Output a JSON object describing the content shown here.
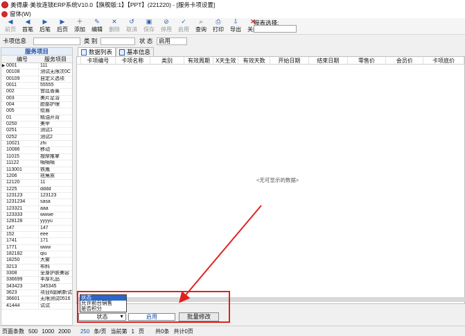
{
  "window": {
    "title": "美得康·美妆连锁ERP系统V10.0【旗舰版:1】【PPT】(221220) - [服务卡项设置]"
  },
  "menu": {
    "label": "窗体(W)"
  },
  "toolbar": {
    "buttons": [
      {
        "label": "前页",
        "icon": "◀",
        "disabled": true
      },
      {
        "label": "首笔",
        "icon": "◀",
        "disabled": false
      },
      {
        "label": "后笔",
        "icon": "▶",
        "disabled": false
      },
      {
        "label": "后页",
        "icon": "▶",
        "disabled": false
      },
      {
        "label": "添加",
        "icon": "＋",
        "disabled": false
      },
      {
        "label": "编辑",
        "icon": "✎",
        "disabled": false
      },
      {
        "label": "删除",
        "icon": "✕",
        "disabled": true
      },
      {
        "label": "取消",
        "icon": "↺",
        "disabled": true
      },
      {
        "label": "保存",
        "icon": "▣",
        "disabled": true
      },
      {
        "label": "停用",
        "icon": "⊘",
        "disabled": true
      },
      {
        "label": "启用",
        "icon": "✓",
        "disabled": true
      },
      {
        "label": "查询",
        "icon": "⌕",
        "disabled": false
      },
      {
        "label": "打印",
        "icon": "⎙",
        "disabled": false
      },
      {
        "label": "导出",
        "icon": "⇩",
        "disabled": false
      },
      {
        "label": "关闭",
        "icon": "✕",
        "disabled": false
      }
    ],
    "report_label": "报表选择:"
  },
  "filter": {
    "card_info_label": "卡项信息",
    "category_label": "类 别",
    "status_label": "状 态",
    "status_value": "启用"
  },
  "left": {
    "title": "服务项目",
    "col_code": "编号",
    "col_name": "服务项目",
    "rows": [
      {
        "code": "0001",
        "name": "111"
      },
      {
        "code": "00108",
        "name": "测试无限次0C"
      },
      {
        "code": "00109",
        "name": "自定义选项"
      },
      {
        "code": "0011",
        "name": "55555"
      },
      {
        "code": "002",
        "name": "宫廷香薰"
      },
      {
        "code": "003",
        "name": "美片足浴"
      },
      {
        "code": "004",
        "name": "脸部护理"
      },
      {
        "code": "005",
        "name": "绘眉"
      },
      {
        "code": "01",
        "name": "精油开背"
      },
      {
        "code": "0250",
        "name": "美甲"
      },
      {
        "code": "0251",
        "name": "测试1"
      },
      {
        "code": "0252",
        "name": "测试2"
      },
      {
        "code": "10021",
        "name": "zhi"
      },
      {
        "code": "10086",
        "name": "移动"
      },
      {
        "code": "11015",
        "name": "按摩推拿"
      },
      {
        "code": "11122",
        "name": "嘀嘀嘀"
      },
      {
        "code": "113001",
        "name": "铁鹰"
      },
      {
        "code": "1206",
        "name": "祛角质"
      },
      {
        "code": "12120",
        "name": "11"
      },
      {
        "code": "1225",
        "name": "dddd"
      },
      {
        "code": "123123",
        "name": "123123"
      },
      {
        "code": "1231234",
        "name": "sasa"
      },
      {
        "code": "123321",
        "name": "aaa"
      },
      {
        "code": "123333",
        "name": "wwwe"
      },
      {
        "code": "128128",
        "name": "yyyyu"
      },
      {
        "code": "147",
        "name": "147"
      },
      {
        "code": "152",
        "name": "eee"
      },
      {
        "code": "1741",
        "name": "171"
      },
      {
        "code": "1771",
        "name": "www"
      },
      {
        "code": "182182",
        "name": "qiu"
      },
      {
        "code": "18250",
        "name": "大雾"
      },
      {
        "code": "3213",
        "name": "布料"
      },
      {
        "code": "3308",
        "name": "全身护肤美容"
      },
      {
        "code": "336699",
        "name": "丰厚礼品"
      },
      {
        "code": "343423",
        "name": "345345"
      },
      {
        "code": "3623",
        "name": "项目8副刷新试"
      },
      {
        "code": "36601",
        "name": "无限测试0516"
      },
      {
        "code": "41444",
        "name": "试试"
      }
    ]
  },
  "tabs": [
    {
      "label": "数据列表",
      "active": true
    },
    {
      "label": "基本信息",
      "active": false
    }
  ],
  "grid": {
    "columns": [
      "卡项编号",
      "卡项名称",
      "类别",
      "有效周期",
      "X天生效",
      "有效天数",
      "开始日期",
      "结束日期",
      "零售价",
      "会员价",
      "卡项底价"
    ],
    "empty_text": "<无可显示的数据>"
  },
  "dropdown": {
    "options": [
      "状态",
      "允许前台销售",
      "是否积分"
    ],
    "selected": 0
  },
  "batch": {
    "field_value": "状态",
    "input_value": "启用",
    "button_label": "批量修改"
  },
  "footer": {
    "page_size_label": "页面条数",
    "sizes": [
      "500",
      "1000",
      "2000"
    ],
    "per_page_value": "250",
    "per_page_unit": "条/页",
    "current_label": "当前第",
    "page": "1",
    "page_unit": "页",
    "total_label": "共0条",
    "total_pages": "共计0页"
  },
  "colors": {
    "accent": "#2a66c8",
    "highlight_red": "#e02020"
  }
}
